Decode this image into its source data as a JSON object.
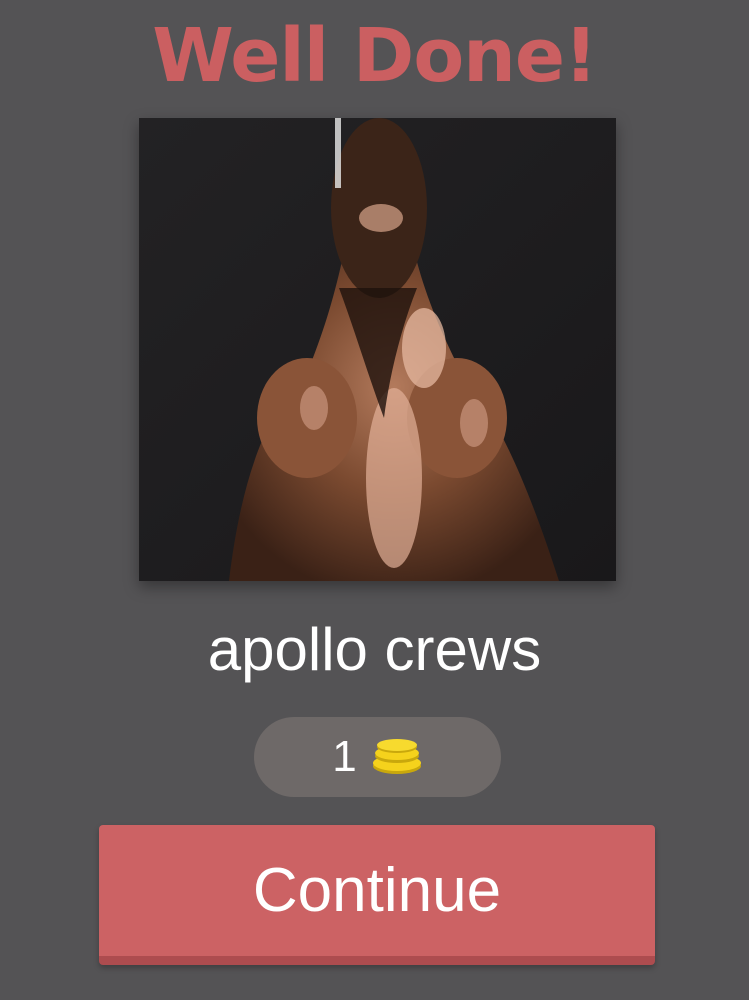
{
  "header": {
    "title": "Well Done!"
  },
  "photo": {
    "subject": "wrestler-portrait"
  },
  "result": {
    "answer": "apollo crews"
  },
  "reward": {
    "count": "1",
    "icon": "coin-stack-icon"
  },
  "actions": {
    "continue_label": "Continue"
  },
  "colors": {
    "background": "#545355",
    "accent": "#cb5f61",
    "button": "#cc6264",
    "button_shadow": "#ad4c4f",
    "reward_pill": "#6e6968",
    "coin": "#f5d21c"
  }
}
